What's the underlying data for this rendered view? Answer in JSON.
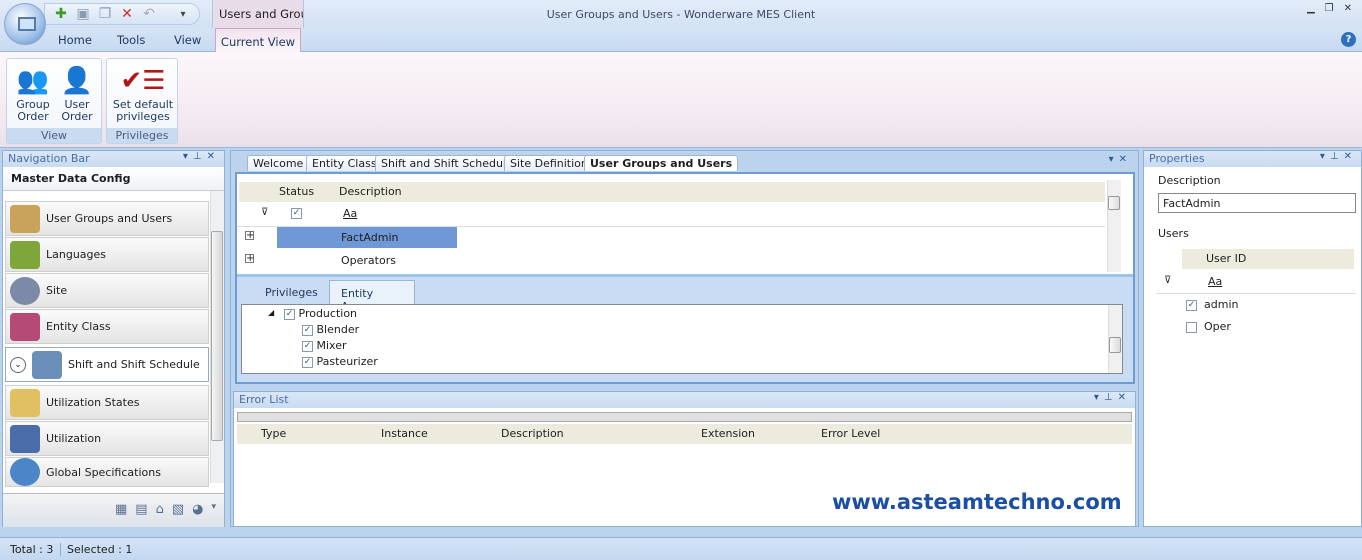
{
  "window": {
    "title": "User Groups and Users  -  Wonderware MES Client",
    "doc_tab": "Users and Grou...",
    "controls": [
      "minimize",
      "restore",
      "close"
    ]
  },
  "qat": {
    "icons": [
      "add-icon",
      "save-icon",
      "copy-icon",
      "delete-icon",
      "undo-icon"
    ]
  },
  "ribbon": {
    "tabs": [
      "Home",
      "Tools",
      "View",
      "Current View"
    ],
    "active_tab": "Current View",
    "groups": [
      {
        "label": "View",
        "buttons": [
          "Group\nOrder",
          "User\nOrder"
        ]
      },
      {
        "label": "Privileges",
        "buttons": [
          "Set default\nprivileges"
        ]
      }
    ]
  },
  "nav": {
    "header": "Navigation Bar",
    "title": "Master Data Config",
    "items": [
      "User Groups and Users",
      "Languages",
      "Site",
      "Entity Class",
      "Shift and Shift Schedule",
      "Utilization States",
      "Utilization",
      "Global Specifications"
    ],
    "selected": "Shift and Shift Schedule"
  },
  "docs": {
    "tabs": [
      "Welcome",
      "Entity Class",
      "Shift and Shift Schedule",
      "Site Definition",
      "User Groups and Users"
    ],
    "active": "User Groups and Users"
  },
  "groups_grid": {
    "columns": [
      "Status",
      "Description"
    ],
    "filter_text": "Aa",
    "rows": [
      {
        "description": "FactAdmin",
        "selected": true
      },
      {
        "description": "Operators",
        "selected": false
      }
    ]
  },
  "sub_tabs": {
    "tabs": [
      "Privileges",
      "Entity Access"
    ],
    "active": "Entity Access"
  },
  "entity_tree": {
    "root": {
      "label": "Production",
      "checked": true
    },
    "children": [
      {
        "label": "Blender",
        "checked": true
      },
      {
        "label": "Mixer",
        "checked": true
      },
      {
        "label": "Pasteurizer",
        "checked": true
      }
    ]
  },
  "error_list": {
    "header": "Error List",
    "columns": [
      "Type",
      "Instance",
      "Description",
      "Extension",
      "Error Level"
    ]
  },
  "properties": {
    "header": "Properties",
    "description_label": "Description",
    "description_value": "FactAdmin",
    "users_label": "Users",
    "users_column": "User ID",
    "filter_text": "Aa",
    "users": [
      {
        "id": "admin",
        "checked": true
      },
      {
        "id": "Oper",
        "checked": false
      }
    ]
  },
  "status": {
    "total": "Total : 3",
    "selected": "Selected : 1"
  },
  "watermark": "www.asteamtechno.com"
}
